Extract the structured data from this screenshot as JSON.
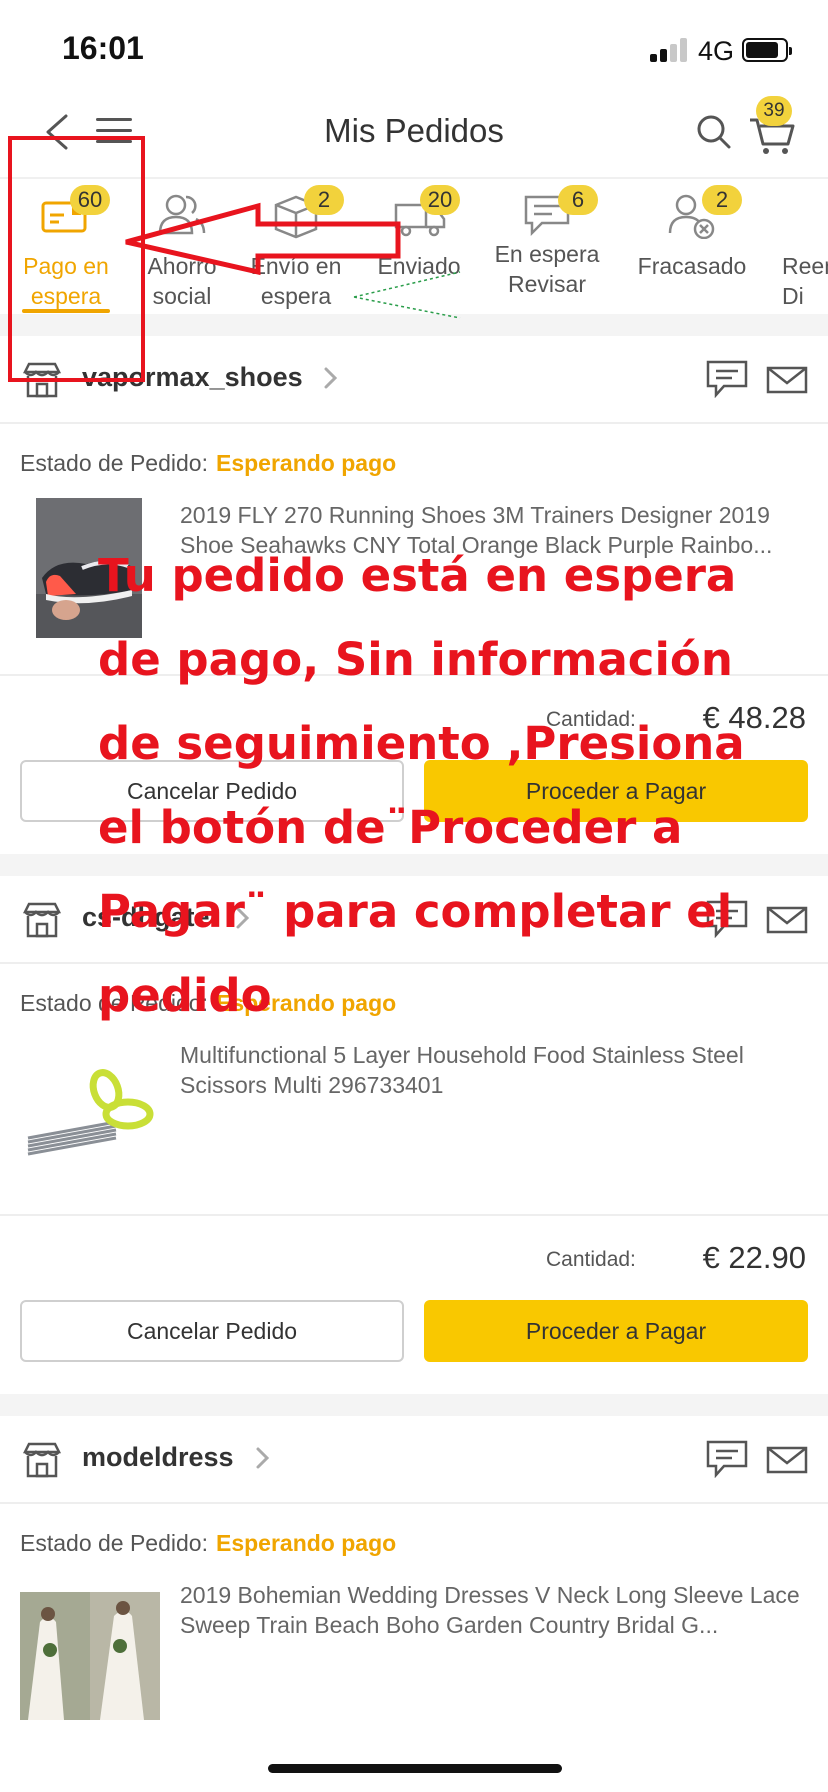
{
  "status_bar": {
    "time": "16:01",
    "network": "4G"
  },
  "nav": {
    "title": "Mis Pedidos",
    "cart_count": "39"
  },
  "tabs": [
    {
      "label": "Pago en espera",
      "badge": "60",
      "icon": "payment-card-icon",
      "active": true
    },
    {
      "label": "Ahorro social",
      "badge": "",
      "icon": "people-icon",
      "active": false
    },
    {
      "label": "Envío en espera",
      "badge": "2",
      "icon": "package-icon",
      "active": false
    },
    {
      "label": "Enviado",
      "badge": "20",
      "icon": "truck-icon",
      "active": false
    },
    {
      "label": "En espera Revisar",
      "badge": "6",
      "icon": "review-chat-icon",
      "active": false
    },
    {
      "label": "Fracasado",
      "badge": "2",
      "icon": "failed-user-icon",
      "active": false
    },
    {
      "label": "Reen Di",
      "badge": "",
      "icon": "",
      "active": false
    }
  ],
  "orders": [
    {
      "store": "vapormax_shoes",
      "status_label": "Estado de Pedido:",
      "status": "Esperando pago",
      "product_title": "2019 FLY 270 Running Shoes 3M Trainers Designer 2019 Shoe Seahawks CNY Total Orange Black Purple Rainbo...",
      "quantity_label": "Cantidad:",
      "price": "€ 48.28",
      "cancel_label": "Cancelar Pedido",
      "pay_label": "Proceder a Pagar"
    },
    {
      "store": "cs-dhgate",
      "status_label": "Estado de Pedido:",
      "status": "Esperando pago",
      "product_title": "Multifunctional 5 Layer Household Food Stainless Steel Scissors Multi 296733401",
      "quantity_label": "Cantidad:",
      "price": "€ 22.90",
      "cancel_label": "Cancelar Pedido",
      "pay_label": "Proceder a Pagar"
    },
    {
      "store": "modeldress",
      "status_label": "Estado de Pedido:",
      "status": "Esperando pago",
      "product_title": "2019 Bohemian Wedding Dresses V Neck Long Sleeve Lace Sweep Train Beach Boho Garden Country Bridal G..."
    }
  ],
  "annotation": {
    "lines": [
      "Tu pedido está en espera",
      "de pago, Sin información",
      "de seguimiento ,Presiona",
      "el botón de¨Proceder a",
      "Pagar¨ para completar el",
      "pedido"
    ],
    "color": "#e8141e"
  },
  "colors": {
    "accent": "#f0a500",
    "badge": "#f2d23c",
    "pay_button": "#f9c800"
  }
}
